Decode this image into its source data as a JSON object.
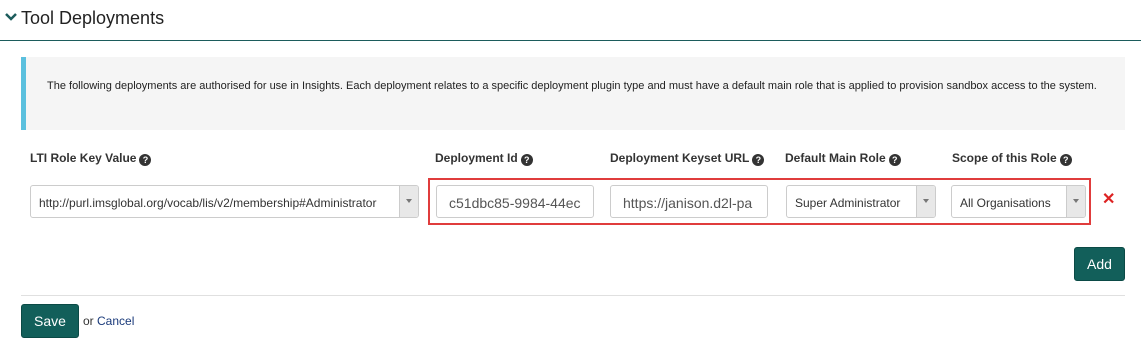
{
  "section": {
    "title": "Tool Deployments",
    "icon": "chevron-down-icon"
  },
  "info": {
    "text": "The following deployments are authorised for use in Insights. Each deployment relates to a specific deployment plugin type and must have a default main role that is applied to provision sandbox access to the system."
  },
  "columns": {
    "lti_role": "LTI Role Key Value",
    "deployment_id": "Deployment Id",
    "keyset_url": "Deployment Keyset URL",
    "main_role": "Default Main Role",
    "scope": "Scope of this Role",
    "help_glyph": "?"
  },
  "row": {
    "lti_role": "http://purl.imsglobal.org/vocab/lis/v2/membership#Administrator",
    "deployment_id": "c51dbc85-9984-44ec",
    "keyset_url": "https://janison.d2l-pa",
    "main_role": "Super Administrator",
    "scope": "All Organisations",
    "delete_glyph": "✕"
  },
  "buttons": {
    "add": "Add",
    "save": "Save",
    "or": "or",
    "cancel": "Cancel"
  },
  "colors": {
    "primary": "#125f5a",
    "highlight": "#e03c3c",
    "info_accent": "#5bc0de",
    "delete": "#dd2222"
  }
}
